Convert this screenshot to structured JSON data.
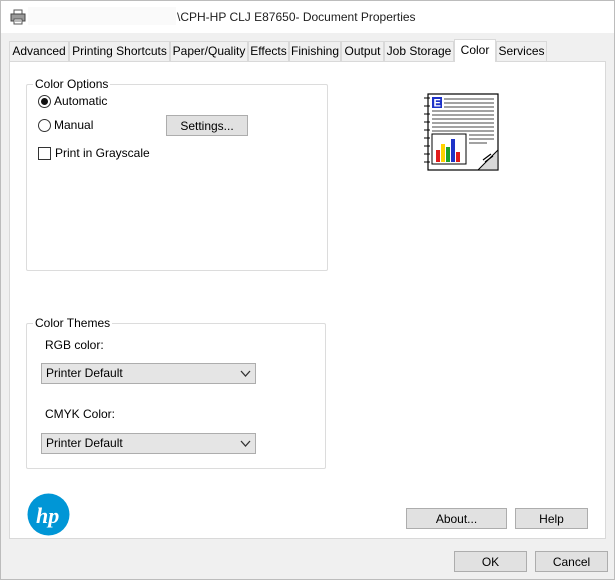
{
  "window": {
    "title": "\\CPH-HP CLJ E87650-        Document Properties"
  },
  "tabs": [
    {
      "label": "Advanced",
      "active": false
    },
    {
      "label": "Printing Shortcuts",
      "active": false
    },
    {
      "label": "Paper/Quality",
      "active": false
    },
    {
      "label": "Effects",
      "active": false
    },
    {
      "label": "Finishing",
      "active": false
    },
    {
      "label": "Output",
      "active": false
    },
    {
      "label": "Job Storage",
      "active": false
    },
    {
      "label": "Color",
      "active": true
    },
    {
      "label": "Services",
      "active": false
    }
  ],
  "color_options": {
    "title": "Color Options",
    "automatic_label": "Automatic",
    "automatic_selected": true,
    "manual_label": "Manual",
    "manual_selected": false,
    "settings_button": "Settings...",
    "grayscale_label": "Print in Grayscale",
    "grayscale_checked": false
  },
  "color_themes": {
    "title": "Color Themes",
    "rgb_label": "RGB color:",
    "rgb_value": "Printer Default",
    "cmyk_label": "CMYK Color:",
    "cmyk_value": "Printer Default"
  },
  "icons": {
    "title_icon": "printer-icon",
    "preview_icon": "color-document-preview-icon",
    "brand_logo": "hp-logo"
  },
  "colors": {
    "hp_blue": "#0096d6",
    "window_bg": "#f0f0f0",
    "button_bg": "#e1e1e1"
  },
  "buttons": {
    "about": "About...",
    "help": "Help",
    "ok": "OK",
    "cancel": "Cancel"
  }
}
